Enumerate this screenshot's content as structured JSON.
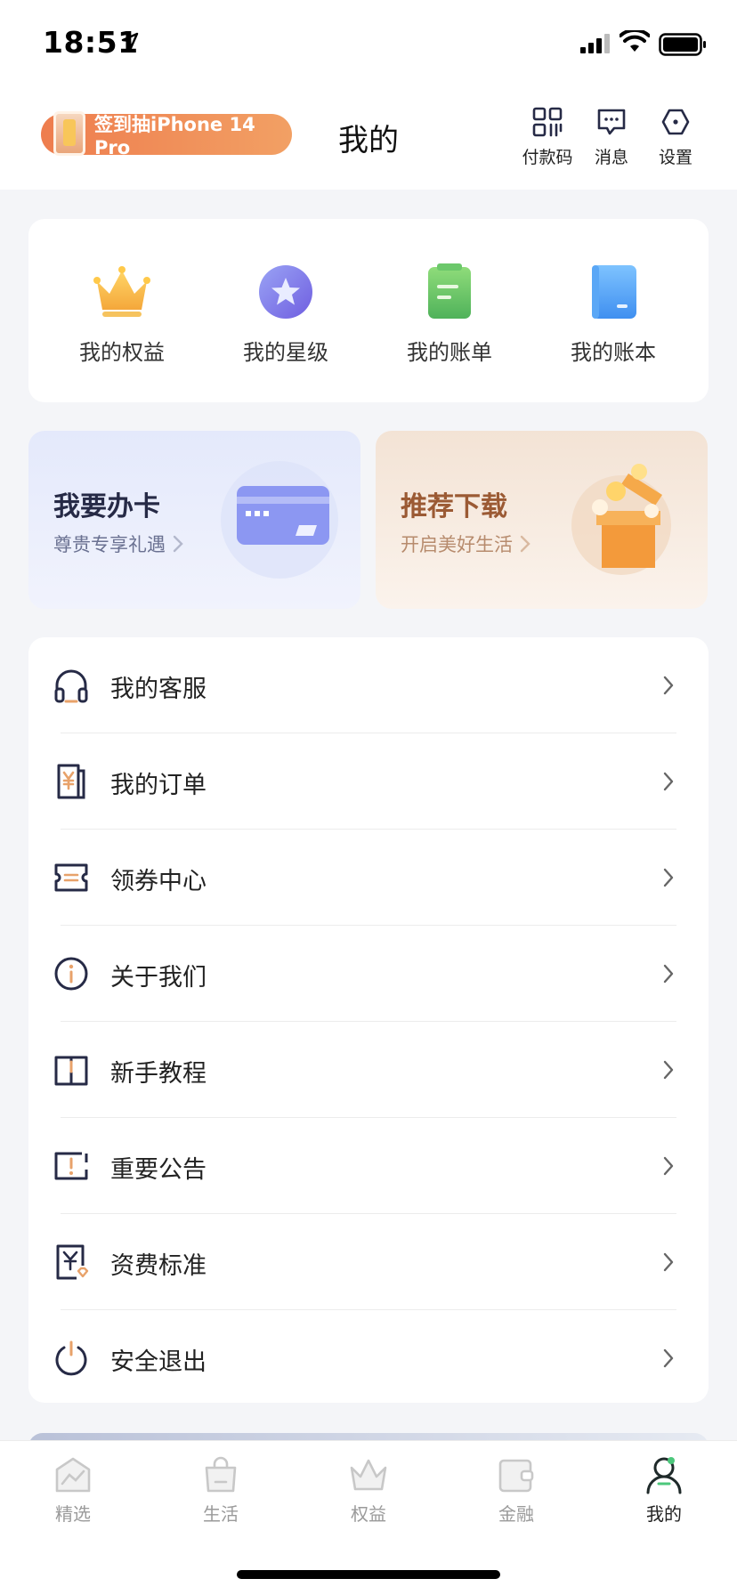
{
  "status_bar": {
    "time": "18:51"
  },
  "header": {
    "promo_label": "签到抽iPhone 14 Pro",
    "title": "我的",
    "actions": [
      {
        "label": "付款码",
        "icon": "qr-code-icon"
      },
      {
        "label": "消息",
        "icon": "message-icon"
      },
      {
        "label": "设置",
        "icon": "settings-icon"
      }
    ]
  },
  "quick_links": [
    {
      "label": "我的权益",
      "icon": "crown-icon"
    },
    {
      "label": "我的星级",
      "icon": "star-icon"
    },
    {
      "label": "我的账单",
      "icon": "bill-icon"
    },
    {
      "label": "我的账本",
      "icon": "ledger-icon"
    }
  ],
  "banners": {
    "card": {
      "title": "我要办卡",
      "subtitle": "尊贵专享礼遇"
    },
    "download": {
      "title": "推荐下载",
      "subtitle": "开启美好生活"
    }
  },
  "menu": [
    {
      "label": "我的客服",
      "icon": "headset-icon"
    },
    {
      "label": "我的订单",
      "icon": "order-icon"
    },
    {
      "label": "领券中心",
      "icon": "coupon-icon"
    },
    {
      "label": "关于我们",
      "icon": "info-icon"
    },
    {
      "label": "新手教程",
      "icon": "book-icon"
    },
    {
      "label": "重要公告",
      "icon": "notice-icon"
    },
    {
      "label": "资费标准",
      "icon": "fee-icon"
    },
    {
      "label": "安全退出",
      "icon": "power-icon"
    }
  ],
  "tabbar": [
    {
      "label": "精选",
      "icon": "featured-icon",
      "active": false
    },
    {
      "label": "生活",
      "icon": "life-bag-icon",
      "active": false
    },
    {
      "label": "权益",
      "icon": "rights-crown-icon",
      "active": false
    },
    {
      "label": "金融",
      "icon": "wallet-icon",
      "active": false
    },
    {
      "label": "我的",
      "icon": "profile-icon",
      "active": true
    }
  ],
  "colors": {
    "accent_orange": "#ee7d4e",
    "icon_navy": "#262a46",
    "icon_accent": "#e8a26a",
    "tab_active": "#222222",
    "tab_inactive": "#9a9a9a"
  }
}
